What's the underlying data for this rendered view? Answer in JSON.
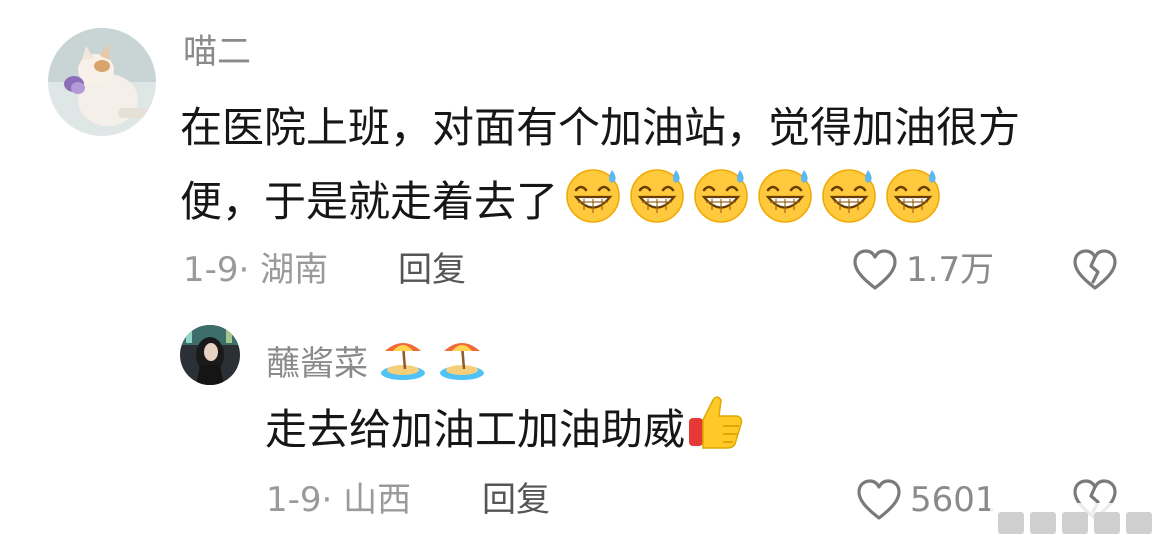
{
  "comments": [
    {
      "username": "喵二",
      "text_line1": "在医院上班，对面有个加油站，觉得加油很方",
      "text_line2": "便，于是就走着去了",
      "date": "1-9",
      "separator": "·",
      "location": "湖南",
      "reply_label": "回复",
      "like_count": "1.7万",
      "emoji": "grinning-sweat-emoji",
      "emoji_count": 6
    },
    {
      "username": "蘸酱菜",
      "username_emoji": "desert-island-emoji",
      "text": "走去给加油工加油助威",
      "text_emoji": "thumbs-up-emoji",
      "date": "1-9",
      "separator": "·",
      "location": "山西",
      "reply_label": "回复",
      "like_count": "5601"
    }
  ],
  "icons": {
    "like": "heart-outline-icon",
    "dislike": "broken-heart-icon"
  },
  "colors": {
    "username": "#8a8a8a",
    "text": "#161616",
    "meta": "#9a9a9a",
    "reply": "#555555",
    "icon": "#7a7a7a"
  }
}
